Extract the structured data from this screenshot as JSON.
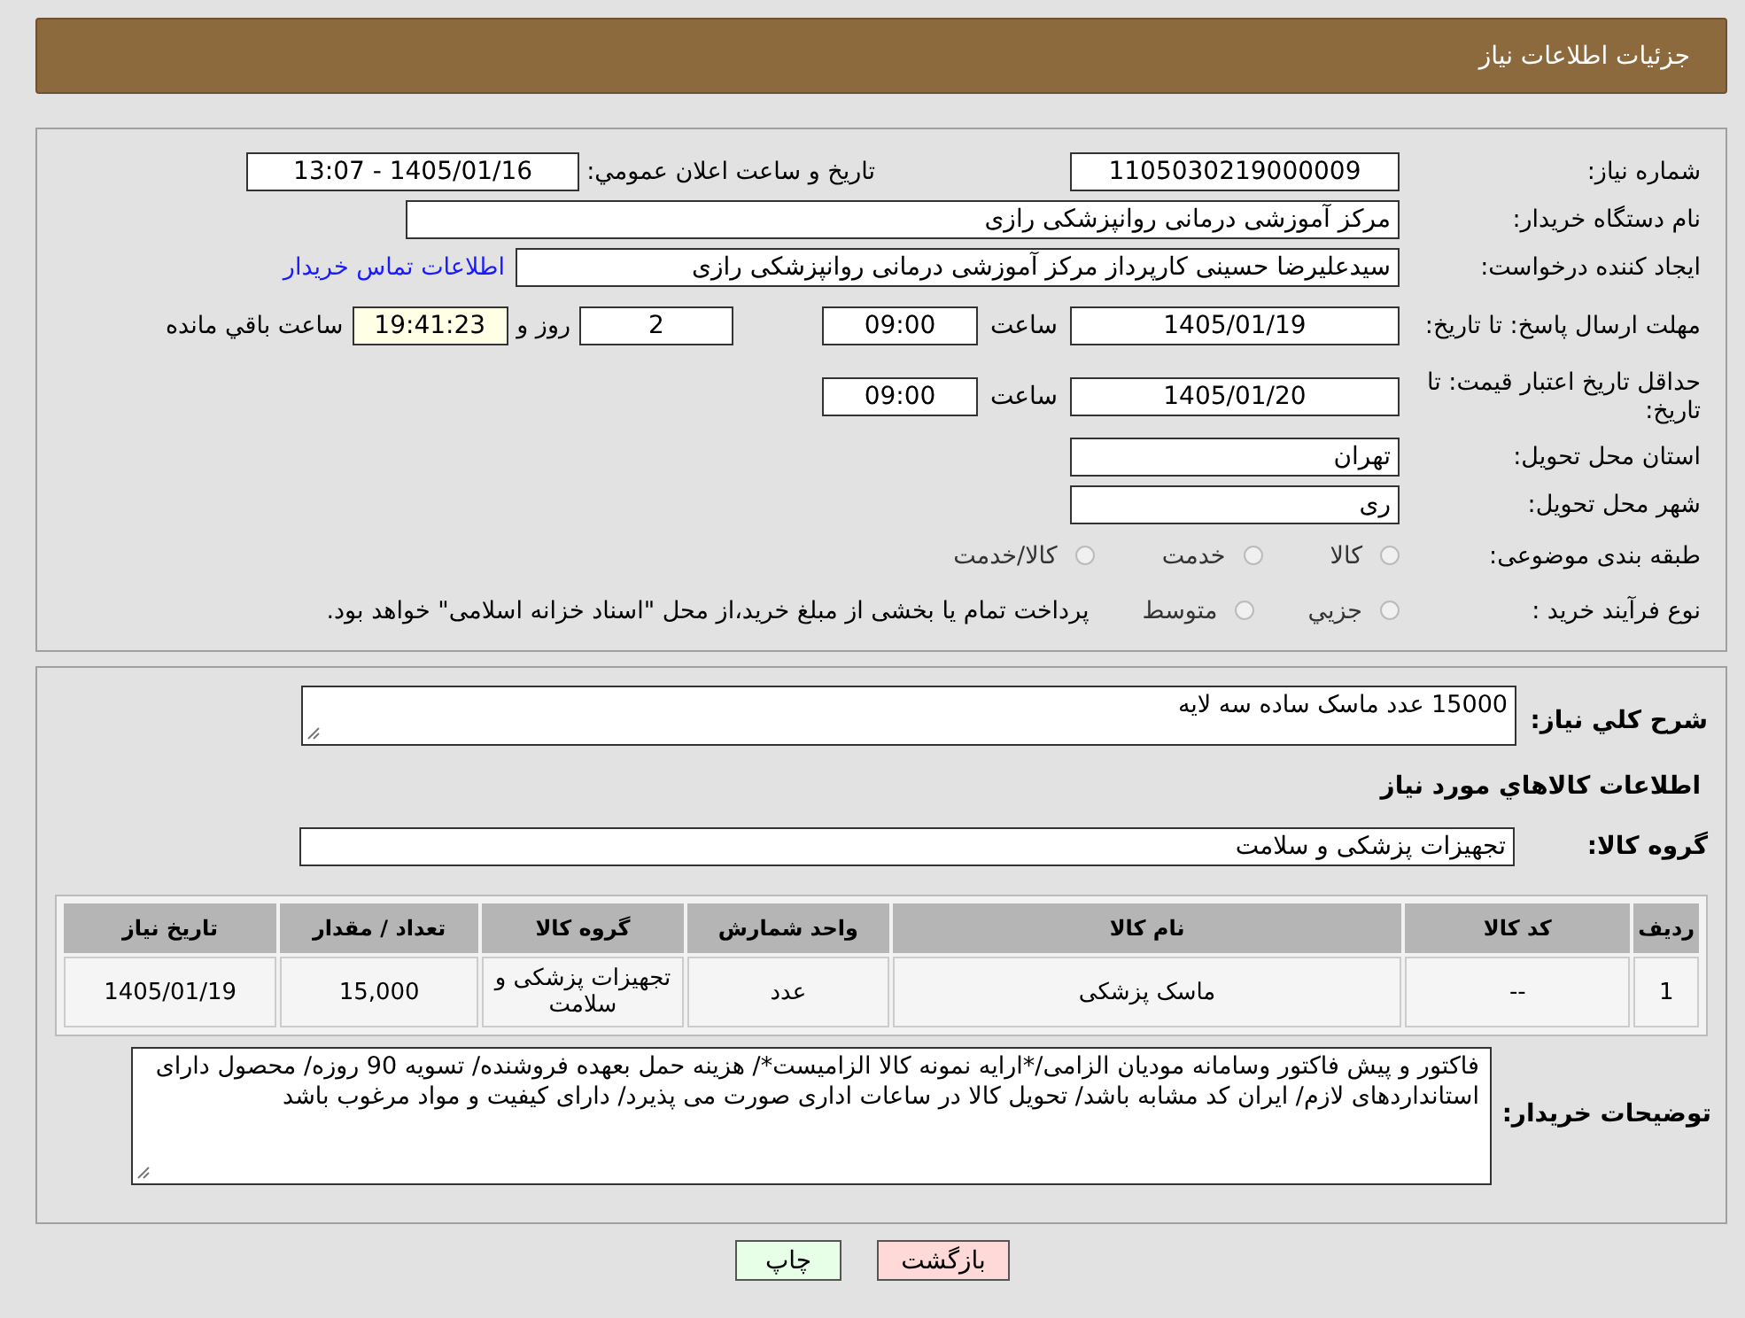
{
  "header": {
    "title": "جزئیات اطلاعات نیاز"
  },
  "need_number": {
    "label": "شماره نیاز:",
    "value": "1105030219000009"
  },
  "announce": {
    "label": "تاریخ و ساعت اعلان عمومي:",
    "value": "1405/01/16 - 13:07"
  },
  "buyer_org": {
    "label": "نام دستگاه خریدار:",
    "value": "مرکز آموزشی درمانی روانپزشکی رازی"
  },
  "creator": {
    "label": "ایجاد کننده درخواست:",
    "value": "سیدعلیرضا حسینی کارپرداز مرکز آموزشی درمانی روانپزشکی رازی",
    "link": "اطلاعات تماس خریدار"
  },
  "response_deadline": {
    "label": "مهلت ارسال پاسخ: تا تاریخ:",
    "date": "1405/01/19",
    "time_label": "ساعت",
    "time": "09:00",
    "days": "2",
    "days_suffix": "روز و",
    "remaining": "19:41:23",
    "remaining_suffix": "ساعت باقي مانده"
  },
  "price_validity": {
    "label": "حداقل تاریخ اعتبار قیمت: تا تاریخ:",
    "date": "1405/01/20",
    "time_label": "ساعت",
    "time": "09:00"
  },
  "province": {
    "label": "استان محل تحویل:",
    "value": "تهران"
  },
  "city": {
    "label": "شهر محل تحویل:",
    "value": "ری"
  },
  "category": {
    "label": "طبقه بندی موضوعی:",
    "options": [
      {
        "label": "کالا",
        "selected": false
      },
      {
        "label": "خدمت",
        "selected": false
      },
      {
        "label": "کالا/خدمت",
        "selected": false
      }
    ]
  },
  "purchase_type": {
    "label": "نوع فرآیند خرید :",
    "options": [
      {
        "label": "جزيي",
        "selected": false
      },
      {
        "label": "متوسط",
        "selected": false
      }
    ],
    "note": "پرداخت تمام یا بخشی از مبلغ خرید،از محل \"اسناد خزانه اسلامی\" خواهد بود."
  },
  "description": {
    "label": "شرح کلي نیاز:",
    "value": "15000 عدد ماسک ساده سه لایه"
  },
  "goods_heading": "اطلاعات کالاهاي مورد نیاز",
  "goods_group": {
    "label": "گروه کالا:",
    "value": "تجهیزات پزشکی و سلامت"
  },
  "table": {
    "columns": [
      "ردیف",
      "کد کالا",
      "نام کالا",
      "واحد شمارش",
      "گروه کالا",
      "تعداد / مقدار",
      "تاریخ نیاز"
    ],
    "rows": [
      [
        "1",
        "--",
        "ماسک پزشکی",
        "عدد",
        "تجهیزات پزشکی و سلامت",
        "15,000",
        "1405/01/19"
      ]
    ]
  },
  "buyer_notes": {
    "label": "توضیحات خریدار:",
    "value": "فاکتور و پیش فاکتور وسامانه مودیان الزامی/*ارایه نمونه کالا الزامیست*/ هزینه حمل بعهده فروشنده/ تسویه 90 روزه/ محصول دارای استانداردهای لازم/ ایران کد مشابه باشد/ تحویل کالا در ساعات اداری صورت می پذیرد/ دارای کیفیت و مواد مرغوب باشد"
  },
  "buttons": [
    {
      "label": "بازگشت",
      "kind": "back"
    },
    {
      "label": "چاپ",
      "kind": "print"
    }
  ]
}
